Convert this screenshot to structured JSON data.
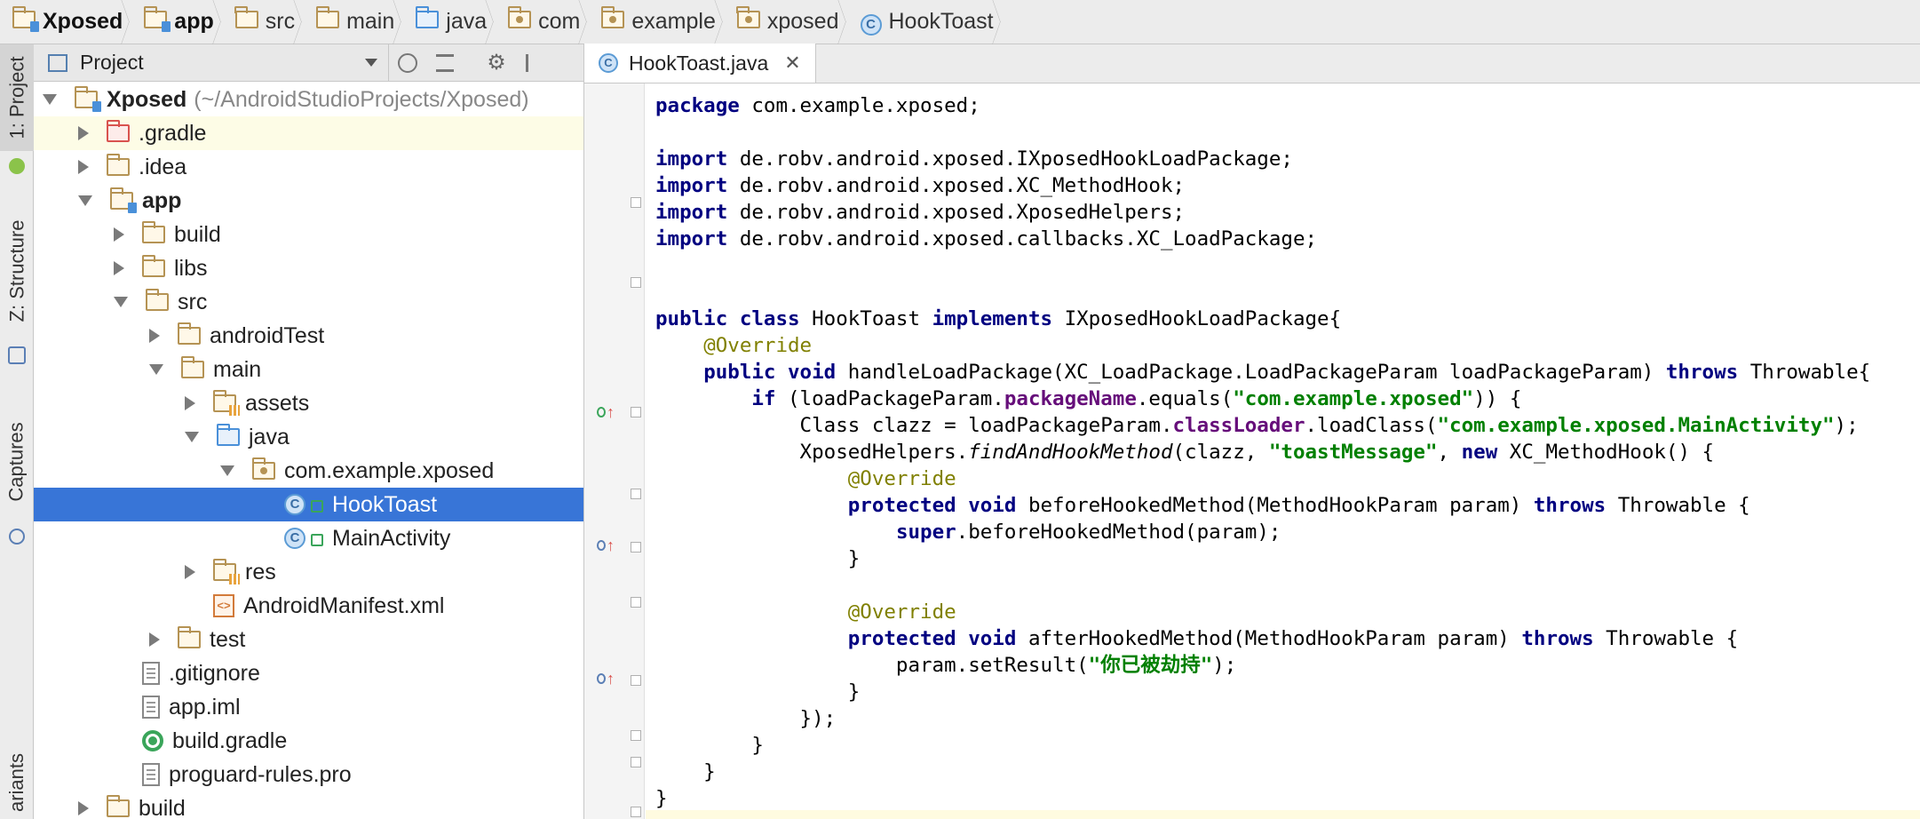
{
  "breadcrumb": [
    {
      "label": "Xposed",
      "icon": "module-folder-icon",
      "bold": true
    },
    {
      "label": "app",
      "icon": "module-folder-icon",
      "bold": true
    },
    {
      "label": "src",
      "icon": "folder-icon"
    },
    {
      "label": "main",
      "icon": "folder-icon"
    },
    {
      "label": "java",
      "icon": "source-folder-icon"
    },
    {
      "label": "com",
      "icon": "package-icon"
    },
    {
      "label": "example",
      "icon": "package-icon"
    },
    {
      "label": "xposed",
      "icon": "package-icon"
    },
    {
      "label": "HookToast",
      "icon": "class-icon"
    }
  ],
  "toolstrip": {
    "project_tab": "1: Project",
    "structure_tab": "Z: Structure",
    "captures_tab": "Captures",
    "variants_tab": "ariants"
  },
  "project_panel": {
    "view_selector": "Project",
    "root_name": "Xposed",
    "root_path": "(~/AndroidStudioProjects/Xposed)",
    "items": [
      {
        "label": ".gradle",
        "depth": 1,
        "arrow": "r",
        "icon": "folder-red"
      },
      {
        "label": ".idea",
        "depth": 1,
        "arrow": "r",
        "icon": "folder"
      },
      {
        "label": "app",
        "depth": 1,
        "arrow": "d",
        "icon": "folder-module",
        "bold": true
      },
      {
        "label": "build",
        "depth": 2,
        "arrow": "r",
        "icon": "folder"
      },
      {
        "label": "libs",
        "depth": 2,
        "arrow": "r",
        "icon": "folder"
      },
      {
        "label": "src",
        "depth": 2,
        "arrow": "d",
        "icon": "folder"
      },
      {
        "label": "androidTest",
        "depth": 3,
        "arrow": "r",
        "icon": "folder"
      },
      {
        "label": "main",
        "depth": 3,
        "arrow": "d",
        "icon": "folder"
      },
      {
        "label": "assets",
        "depth": 4,
        "arrow": "r",
        "icon": "folder-res"
      },
      {
        "label": "java",
        "depth": 4,
        "arrow": "d",
        "icon": "folder-blue"
      },
      {
        "label": "com.example.xposed",
        "depth": 5,
        "arrow": "d",
        "icon": "package"
      },
      {
        "label": "HookToast",
        "depth": 6,
        "arrow": "none",
        "icon": "class",
        "selected": true
      },
      {
        "label": "MainActivity",
        "depth": 6,
        "arrow": "none",
        "icon": "class"
      },
      {
        "label": "res",
        "depth": 4,
        "arrow": "r",
        "icon": "folder-res"
      },
      {
        "label": "AndroidManifest.xml",
        "depth": 4,
        "arrow": "none",
        "icon": "xml"
      },
      {
        "label": "test",
        "depth": 3,
        "arrow": "r",
        "icon": "folder"
      },
      {
        "label": ".gitignore",
        "depth": 2,
        "arrow": "none",
        "icon": "file"
      },
      {
        "label": "app.iml",
        "depth": 2,
        "arrow": "none",
        "icon": "file"
      },
      {
        "label": "build.gradle",
        "depth": 2,
        "arrow": "none",
        "icon": "gradle"
      },
      {
        "label": "proguard-rules.pro",
        "depth": 2,
        "arrow": "none",
        "icon": "file"
      },
      {
        "label": "build",
        "depth": 1,
        "arrow": "r",
        "icon": "folder"
      }
    ]
  },
  "editor": {
    "tab_label": "HookToast.java",
    "tab_close": "✕",
    "code_lines": [
      [
        [
          "kw",
          "package"
        ],
        [
          "t",
          " com.example.xposed;"
        ]
      ],
      [],
      [
        [
          "kw",
          "import"
        ],
        [
          "t",
          " de.robv.android.xposed.IXposedHookLoadPackage;"
        ]
      ],
      [
        [
          "kw",
          "import"
        ],
        [
          "t",
          " de.robv.android.xposed.XC_MethodHook;"
        ]
      ],
      [
        [
          "kw",
          "import"
        ],
        [
          "t",
          " de.robv.android.xposed.XposedHelpers;"
        ]
      ],
      [
        [
          "kw",
          "import"
        ],
        [
          "t",
          " de.robv.android.xposed.callbacks.XC_LoadPackage;"
        ]
      ],
      [],
      [],
      [
        [
          "kw",
          "public class"
        ],
        [
          "t",
          " HookToast "
        ],
        [
          "kw",
          "implements"
        ],
        [
          "t",
          " IXposedHookLoadPackage{"
        ]
      ],
      [
        [
          "t",
          "    "
        ],
        [
          "ann",
          "@Override"
        ]
      ],
      [
        [
          "t",
          "    "
        ],
        [
          "kw",
          "public void"
        ],
        [
          "t",
          " handleLoadPackage(XC_LoadPackage.LoadPackageParam loadPackageParam) "
        ],
        [
          "kw",
          "throws"
        ],
        [
          "t",
          " Throwable{"
        ]
      ],
      [
        [
          "t",
          "        "
        ],
        [
          "kw",
          "if"
        ],
        [
          "t",
          " (loadPackageParam."
        ],
        [
          "fld",
          "packageName"
        ],
        [
          "t",
          ".equals("
        ],
        [
          "str",
          "\"com.example.xposed\""
        ],
        [
          "t",
          ")) {"
        ]
      ],
      [
        [
          "t",
          "            Class clazz = loadPackageParam."
        ],
        [
          "fld",
          "classLoader"
        ],
        [
          "t",
          ".loadClass("
        ],
        [
          "str",
          "\"com.example.xposed.MainActivity\""
        ],
        [
          "t",
          ");"
        ]
      ],
      [
        [
          "t",
          "            XposedHelpers."
        ],
        [
          "it",
          "findAndHookMethod"
        ],
        [
          "t",
          "(clazz, "
        ],
        [
          "str",
          "\"toastMessage\""
        ],
        [
          "t",
          ", "
        ],
        [
          "kw",
          "new"
        ],
        [
          "t",
          " XC_MethodHook() {"
        ]
      ],
      [
        [
          "t",
          "                "
        ],
        [
          "ann",
          "@Override"
        ]
      ],
      [
        [
          "t",
          "                "
        ],
        [
          "kw",
          "protected void"
        ],
        [
          "t",
          " beforeHookedMethod(MethodHookParam param) "
        ],
        [
          "kw",
          "throws"
        ],
        [
          "t",
          " Throwable {"
        ]
      ],
      [
        [
          "t",
          "                    "
        ],
        [
          "kw",
          "super"
        ],
        [
          "t",
          ".beforeHookedMethod(param);"
        ]
      ],
      [
        [
          "t",
          "                }"
        ]
      ],
      [],
      [
        [
          "t",
          "                "
        ],
        [
          "ann",
          "@Override"
        ]
      ],
      [
        [
          "t",
          "                "
        ],
        [
          "kw",
          "protected void"
        ],
        [
          "t",
          " afterHookedMethod(MethodHookParam param) "
        ],
        [
          "kw",
          "throws"
        ],
        [
          "t",
          " Throwable {"
        ]
      ],
      [
        [
          "t",
          "                    param.setResult("
        ],
        [
          "str",
          "\"你已被劫持\""
        ],
        [
          "t",
          ");"
        ]
      ],
      [
        [
          "t",
          "                }"
        ]
      ],
      [
        [
          "t",
          "            });"
        ]
      ],
      [
        [
          "t",
          "        }"
        ]
      ],
      [
        [
          "t",
          "    }"
        ]
      ],
      [
        [
          "t",
          "}"
        ]
      ]
    ]
  },
  "colors": {
    "selection": "#3875d7",
    "keyword": "#000080",
    "annotation": "#808000",
    "string": "#008000",
    "field": "#660e7a"
  }
}
